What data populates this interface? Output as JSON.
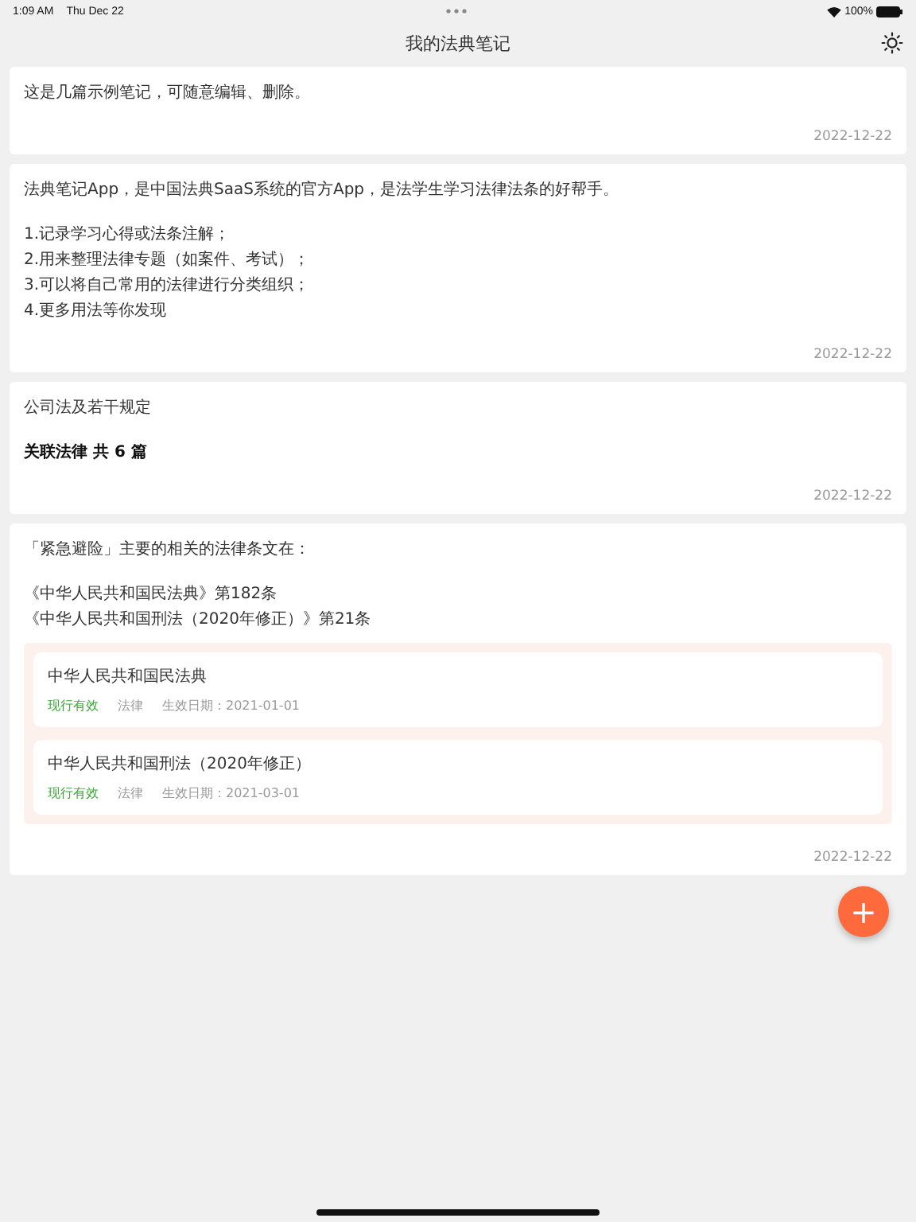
{
  "status_bar": {
    "time": "1:09 AM",
    "date": "Thu Dec 22",
    "battery": "100%"
  },
  "nav": {
    "title": "我的法典笔记"
  },
  "notes": [
    {
      "blocks": [
        {
          "kind": "text",
          "lines": [
            "这是几篇示例笔记，可随意编辑、删除。"
          ]
        }
      ],
      "date": "2022-12-22"
    },
    {
      "blocks": [
        {
          "kind": "text",
          "lines": [
            "法典笔记App，是中国法典SaaS系统的官方App，是法学生学习法律法条的好帮手。"
          ]
        },
        {
          "kind": "text",
          "lines": [
            "1.记录学习心得或法条注解；",
            "2.用来整理法律专题（如案件、考试）；",
            "3.可以将自己常用的法律进行分类组织；",
            "4.更多用法等你发现"
          ]
        }
      ],
      "date": "2022-12-22"
    },
    {
      "blocks": [
        {
          "kind": "text",
          "lines": [
            "公司法及若干规定"
          ]
        },
        {
          "kind": "bold",
          "lines": [
            "关联法律 共 6 篇"
          ]
        }
      ],
      "date": "2022-12-22"
    },
    {
      "blocks": [
        {
          "kind": "text",
          "lines": [
            "「紧急避险」主要的相关的法律条文在："
          ]
        },
        {
          "kind": "text",
          "lines": [
            "《中华人民共和国民法典》第182条",
            "《中华人民共和国刑法（2020年修正）》第21条"
          ]
        },
        {
          "kind": "laws",
          "laws": [
            {
              "title": "中华人民共和国民法典",
              "status": "现行有效",
              "type": "法律",
              "effective": "生效日期：2021-01-01"
            },
            {
              "title": "中华人民共和国刑法（2020年修正）",
              "status": "现行有效",
              "type": "法律",
              "effective": "生效日期：2021-03-01"
            }
          ]
        }
      ],
      "date": "2022-12-22"
    }
  ],
  "fab": {
    "label": "+"
  }
}
